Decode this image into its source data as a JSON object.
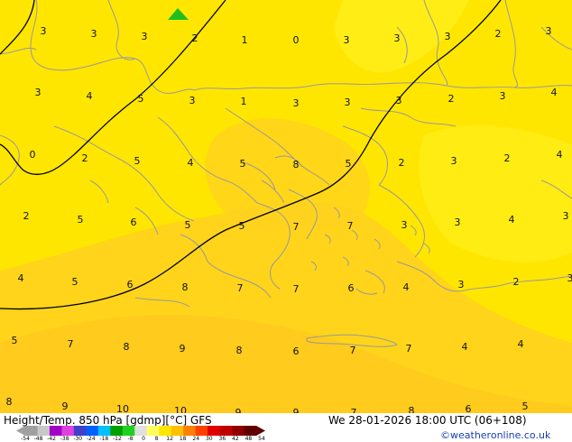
{
  "title": "Height/Temp. 850 hPa [gdmp][°C] GFS",
  "datetime": "We 28-01-2026 18:00 UTC (06+108)",
  "credit": "©weatheronline.co.uk",
  "colors": {
    "map_base": "#ffe600",
    "map_warm": "#ffd21e",
    "map_warmer": "#ffc81e",
    "contour": "#000000",
    "coast": "#9a9a9a",
    "marker": "#1fbf1f"
  },
  "legend_ticks": [
    "-54",
    "-48",
    "-42",
    "-38",
    "-30",
    "-24",
    "-18",
    "-12",
    "-8",
    "0",
    "8",
    "12",
    "18",
    "24",
    "30",
    "36",
    "42",
    "48",
    "54"
  ],
  "legend_colors": [
    "#a0a0a0",
    "#c8c8c8",
    "#a000c8",
    "#e040e0",
    "#4040c8",
    "#0060ff",
    "#00c0ff",
    "#00a000",
    "#20d020",
    "#e0e0e0",
    "#ffff60",
    "#ffe600",
    "#ffc000",
    "#ff8000",
    "#ff4000",
    "#e00000",
    "#c00000",
    "#900000",
    "#600000"
  ],
  "temperatures": [
    {
      "v": "3"
    },
    {
      "v": "3"
    },
    {
      "v": "3"
    },
    {
      "v": "2"
    },
    {
      "v": "1"
    },
    {
      "v": "0"
    },
    {
      "v": "3"
    },
    {
      "v": "3"
    },
    {
      "v": "3"
    },
    {
      "v": "2"
    },
    {
      "v": "3"
    },
    {
      "v": "3"
    },
    {
      "v": "4"
    },
    {
      "v": "5"
    },
    {
      "v": "3"
    },
    {
      "v": "1"
    },
    {
      "v": "3"
    },
    {
      "v": "3"
    },
    {
      "v": "3"
    },
    {
      "v": "2"
    },
    {
      "v": "3"
    },
    {
      "v": "4"
    },
    {
      "v": "0"
    },
    {
      "v": "2"
    },
    {
      "v": "5"
    },
    {
      "v": "4"
    },
    {
      "v": "5"
    },
    {
      "v": "8"
    },
    {
      "v": "5"
    },
    {
      "v": "2"
    },
    {
      "v": "3"
    },
    {
      "v": "2"
    },
    {
      "v": "4"
    },
    {
      "v": "2"
    },
    {
      "v": "5"
    },
    {
      "v": "6"
    },
    {
      "v": "5"
    },
    {
      "v": "5"
    },
    {
      "v": "7"
    },
    {
      "v": "7"
    },
    {
      "v": "3"
    },
    {
      "v": "3"
    },
    {
      "v": "4"
    },
    {
      "v": "3"
    },
    {
      "v": "4"
    },
    {
      "v": "5"
    },
    {
      "v": "6"
    },
    {
      "v": "8"
    },
    {
      "v": "7"
    },
    {
      "v": "7"
    },
    {
      "v": "6"
    },
    {
      "v": "4"
    },
    {
      "v": "3"
    },
    {
      "v": "2"
    },
    {
      "v": "3"
    },
    {
      "v": "5"
    },
    {
      "v": "7"
    },
    {
      "v": "8"
    },
    {
      "v": "9"
    },
    {
      "v": "8"
    },
    {
      "v": "6"
    },
    {
      "v": "7"
    },
    {
      "v": "7"
    },
    {
      "v": "4"
    },
    {
      "v": "4"
    },
    {
      "v": "8"
    },
    {
      "v": "9"
    },
    {
      "v": "10"
    },
    {
      "v": "10"
    },
    {
      "v": "9"
    },
    {
      "v": "9"
    },
    {
      "v": "7"
    },
    {
      "v": "8"
    },
    {
      "v": "6"
    },
    {
      "v": "5"
    }
  ]
}
